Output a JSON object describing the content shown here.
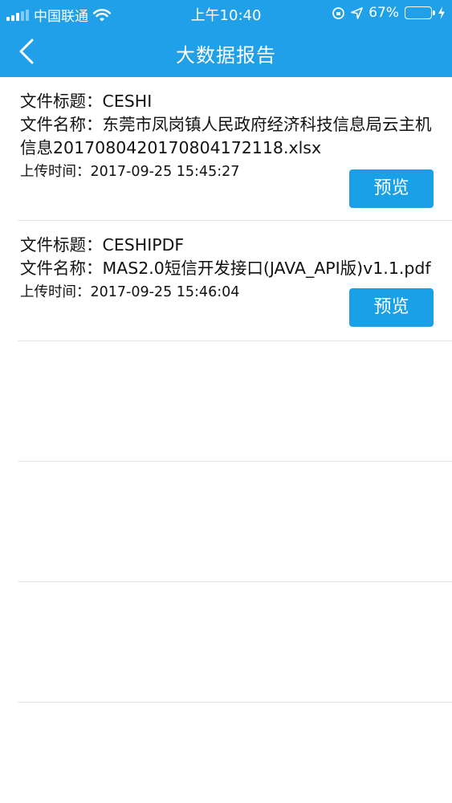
{
  "status_bar": {
    "carrier": "中国联通",
    "time": "上午10:40",
    "battery_percent": "67%",
    "battery_level": 0.67
  },
  "header": {
    "title": "大数据报告",
    "back_icon": "chevron-left-icon"
  },
  "colors": {
    "primary": "#1fa0e8",
    "button": "#1aa0e6",
    "divider": "#e4e4e4",
    "battery_fill": "#5ef05a"
  },
  "reports": [
    {
      "title_label": "文件标题：",
      "title": "CESHI",
      "name_label": "文件名称：",
      "name": "东莞市凤岗镇人民政府经济科技信息局云主机信息2017080420170804172118.xlsx",
      "time_label": "上传时间：",
      "time": "2017-09-25 15:45:27",
      "button_label": "预览"
    },
    {
      "title_label": "文件标题：",
      "title": "CESHIPDF",
      "name_label": "文件名称：",
      "name": "MAS2.0短信开发接口(JAVA_API版)v1.1.pdf",
      "time_label": "上传时间：",
      "time": "2017-09-25 15:46:04",
      "button_label": "预览"
    }
  ]
}
